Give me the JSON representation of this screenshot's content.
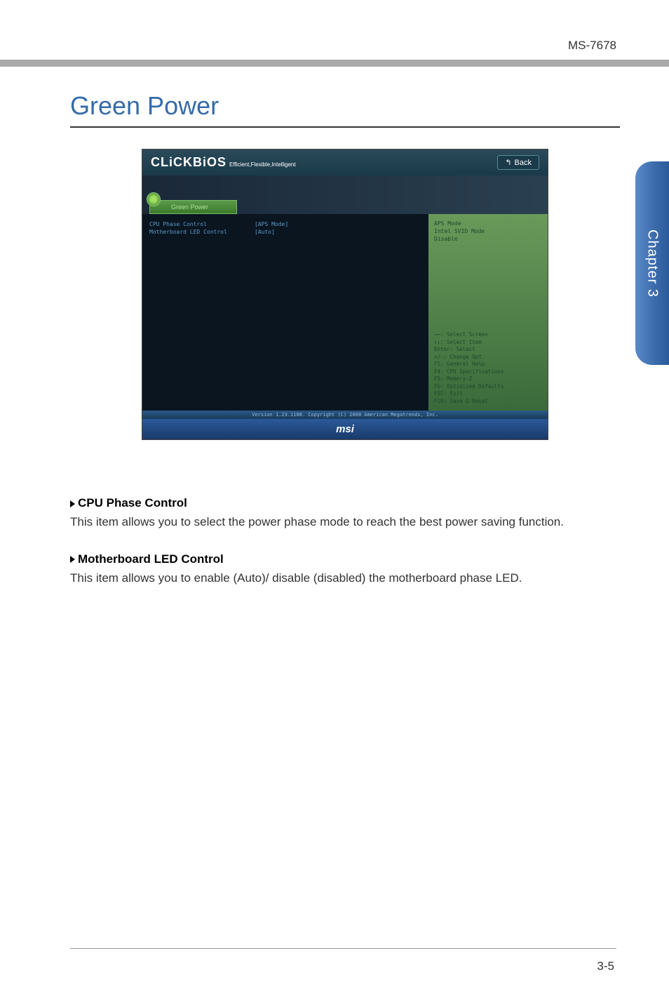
{
  "header": {
    "model": "MS-7678"
  },
  "section_title": "Green Power",
  "bios": {
    "logo_main": "CLiCKBiOS",
    "logo_sub": "Efficient,Flexible,Intelligent",
    "back_label": "Back",
    "tab_label": "Green Power",
    "settings": [
      {
        "label": "CPU Phase Control",
        "value": "[APS Mode]"
      },
      {
        "label": "Motherboard LED Control",
        "value": "[Auto]"
      }
    ],
    "help_options": [
      "APS Mode",
      "Intel SVID Mode",
      "Disable"
    ],
    "nav_help": [
      "→←: Select Screen",
      "↑↓: Select Item",
      "Enter: Select",
      "+/-: Change Opt.",
      "F1: General Help",
      "F4: CPU Specifications",
      "F5: Memory-Z",
      "F6: Optimized Defaults",
      "ESC: Exit",
      "F10: Save & Reset"
    ],
    "version_line": "Version 1.23.1108. Copyright (C) 2008 American Megatrends, Inc.",
    "brand": "msi"
  },
  "descriptions": [
    {
      "heading": "CPU Phase Control",
      "text": "This item allows you to select the power phase mode to reach the best power saving function."
    },
    {
      "heading": "Motherboard LED Control",
      "text": "This item allows you to enable (Auto)/ disable (disabled) the motherboard phase LED."
    }
  ],
  "chapter_tab": "Chapter 3",
  "page_number": "3-5"
}
